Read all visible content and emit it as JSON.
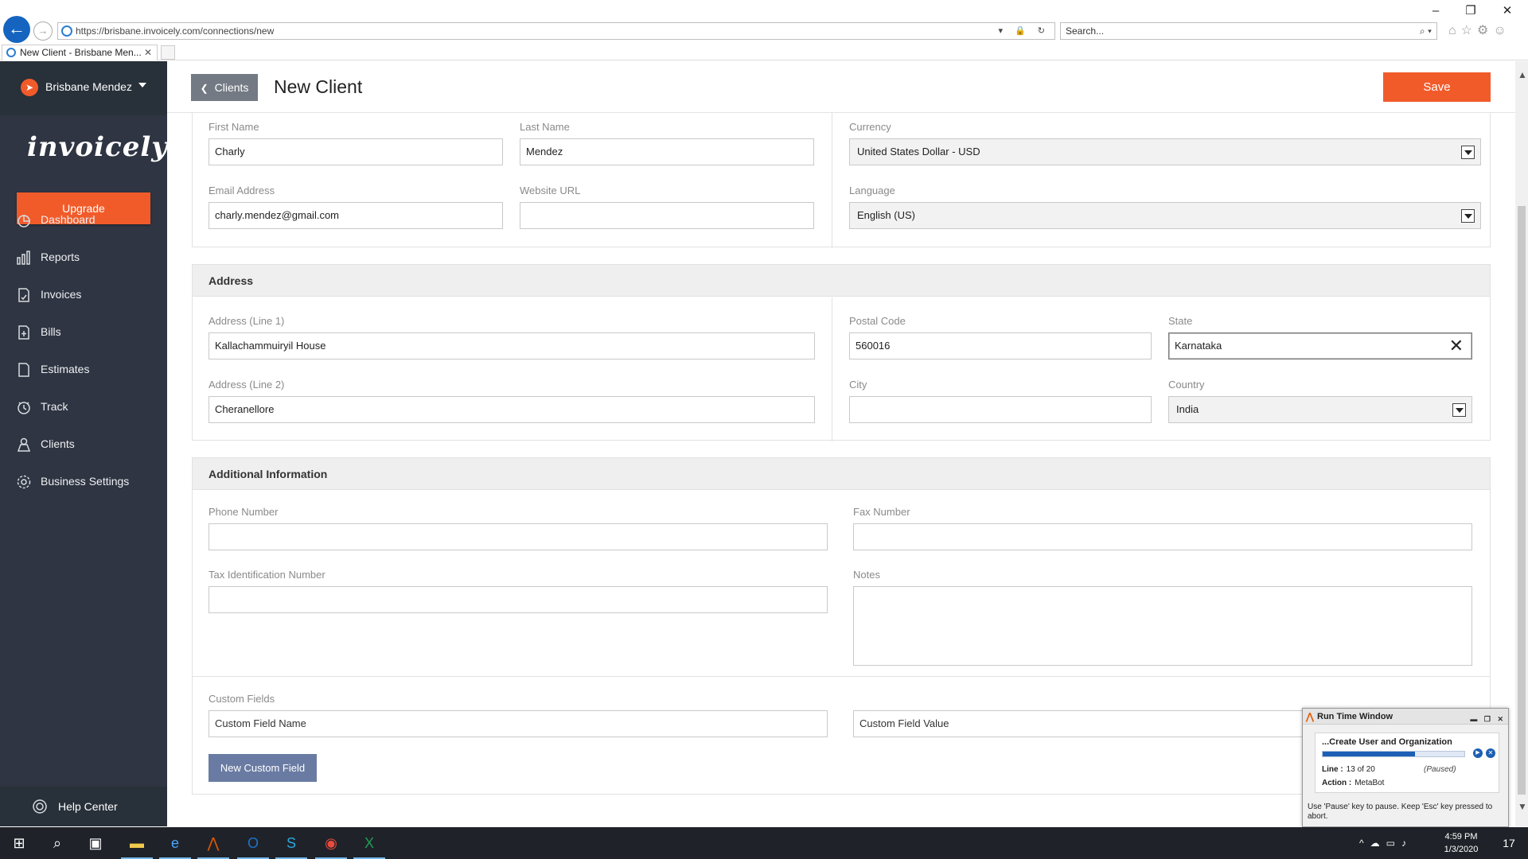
{
  "browser": {
    "url": "https://brisbane.invoicely.com/connections/new",
    "search_placeholder": "Search...",
    "tab_title": "New Client - Brisbane Men...",
    "window_controls": [
      "–",
      "❐",
      "✕"
    ]
  },
  "sidebar": {
    "user_name": "Brisbane Mendez",
    "logo": "invoicely",
    "upgrade": "Upgrade",
    "items": [
      {
        "label": "Dashboard",
        "icon": "dashboard-icon"
      },
      {
        "label": "Reports",
        "icon": "reports-icon"
      },
      {
        "label": "Invoices",
        "icon": "invoices-icon"
      },
      {
        "label": "Bills",
        "icon": "bills-icon"
      },
      {
        "label": "Estimates",
        "icon": "estimates-icon"
      },
      {
        "label": "Track",
        "icon": "track-icon"
      },
      {
        "label": "Clients",
        "icon": "clients-icon"
      },
      {
        "label": "Business Settings",
        "icon": "settings-icon"
      }
    ],
    "help": "Help Center"
  },
  "header": {
    "back_label": "Clients",
    "title": "New Client",
    "save": "Save"
  },
  "contact": {
    "first_name_label": "First Name",
    "first_name": "Charly",
    "last_name_label": "Last Name",
    "last_name": "Mendez",
    "email_label": "Email Address",
    "email": "charly.mendez@gmail.com",
    "website_label": "Website URL",
    "website": "",
    "currency_label": "Currency",
    "currency": "United States Dollar - USD",
    "language_label": "Language",
    "language": "English (US)"
  },
  "address": {
    "heading": "Address",
    "line1_label": "Address (Line 1)",
    "line1": "Kallachammuiryil House",
    "line2_label": "Address (Line 2)",
    "line2": "Cheranellore",
    "postal_label": "Postal Code",
    "postal": "560016",
    "state_label": "State",
    "state": "Karnataka",
    "city_label": "City",
    "city": "",
    "country_label": "Country",
    "country": "India"
  },
  "additional": {
    "heading": "Additional Information",
    "phone_label": "Phone Number",
    "fax_label": "Fax Number",
    "tax_label": "Tax Identification Number",
    "notes_label": "Notes",
    "custom_label": "Custom Fields",
    "custom_name_placeholder": "Custom Field Name",
    "custom_value_placeholder": "Custom Field Value",
    "new_custom": "New Custom Field"
  },
  "runtime": {
    "title": "Run Time Window",
    "task": "...Create User and Organization",
    "progress": 0.65,
    "line_label": "Line :",
    "line_value": "13 of 20",
    "status": "(Paused)",
    "action_label": "Action :",
    "action_value": "MetaBot",
    "hint": "Use 'Pause' key to pause. Keep 'Esc' key pressed to abort."
  },
  "taskbar": {
    "time": "4:59 PM",
    "date": "1/3/2020",
    "notifications": "17"
  },
  "colors": {
    "accent": "#f15b2a",
    "sidebar": "#2f3542",
    "secondary_button": "#6a7ba3"
  }
}
